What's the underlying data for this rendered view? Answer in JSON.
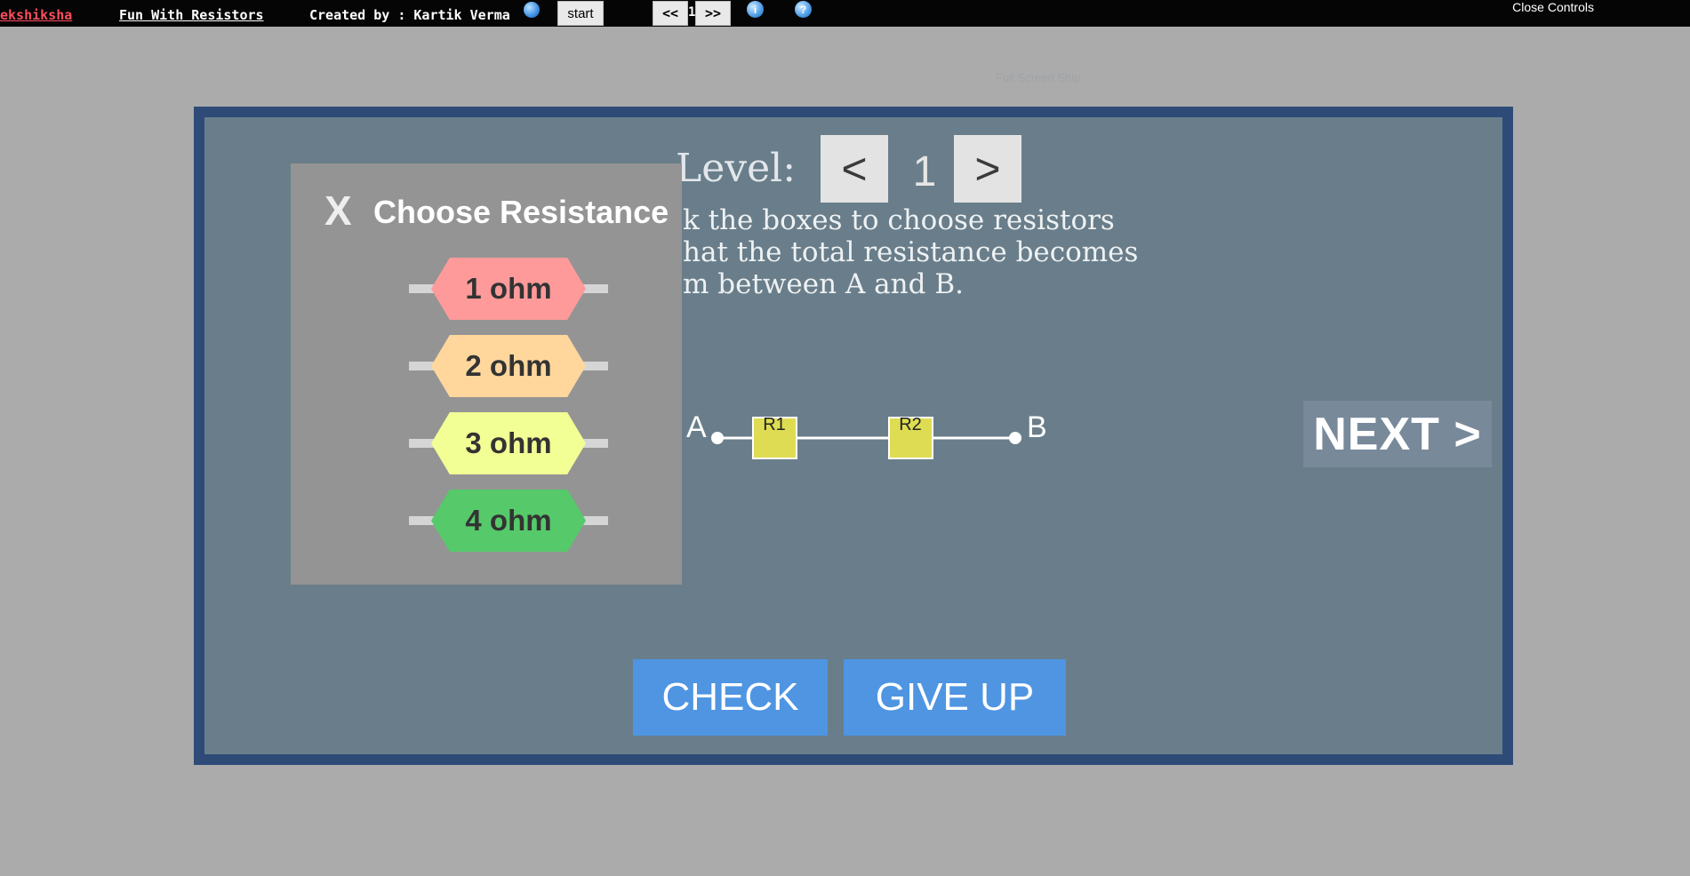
{
  "topbar": {
    "brand": "ekshiksha",
    "title": "Fun With Resistors",
    "credit": "Created by : Kartik Verma",
    "start_label": "start",
    "prev_label": "<<",
    "page_number": "1",
    "next_label": ">>",
    "info_icon_glyph": "i",
    "help_icon_glyph": "?",
    "close_controls": "Close Controls"
  },
  "fullscreen_strip": "Full Screen Ship",
  "level": {
    "label": "Level:",
    "prev": "<",
    "value": "1",
    "next": ">"
  },
  "instructions": [
    "k the boxes to choose resistors",
    "hat the total resistance becomes",
    "m between A and B."
  ],
  "circuit": {
    "node_a": "A",
    "node_b": "B",
    "r1": "R1",
    "r2": "R2",
    "box_color": "#dedc52"
  },
  "next_button": "NEXT >",
  "check_button": "CHECK",
  "giveup_button": "GIVE UP",
  "popup": {
    "close": "X",
    "title": "Choose Resistance",
    "options": [
      {
        "label": "1 ohm",
        "color": "#ff9a9a"
      },
      {
        "label": "2 ohm",
        "color": "#ffd79c"
      },
      {
        "label": "3 ohm",
        "color": "#f2ff94"
      },
      {
        "label": "4 ohm",
        "color": "#56c96a"
      }
    ]
  },
  "colors": {
    "background": "#ababab",
    "frame": "#2e4b78",
    "stage": "#697e8a",
    "button_blue": "#4f95e2"
  }
}
